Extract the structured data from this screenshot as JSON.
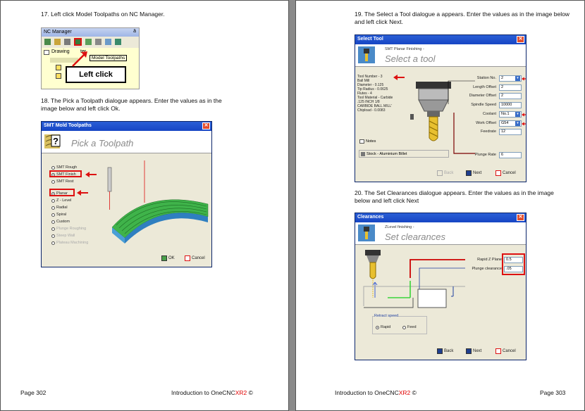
{
  "left_page": {
    "step17": "17. Left click Model Toolpaths on NC Manager.",
    "nc_manager": {
      "title": "NC Manager",
      "pin": "ä",
      "tree_drawing": "Drawing",
      "tree_partial": "ter",
      "tooltip": "Model Toolpaths",
      "callout": "Left click"
    },
    "step18": "18. The Pick a Toolpath dialogue appears. Enter the values as in the image below and left click Ok.",
    "toolpath_dialog": {
      "title": "SMT Mold Toolpaths",
      "heading": "Pick a Toolpath",
      "options": [
        "SMT Rough",
        "SMT Finish",
        "SMT Rest"
      ],
      "options2": [
        "Planar",
        "Z - Level",
        "Radial",
        "Spiral",
        "Custom"
      ],
      "disabled_options": [
        "Plunge Roughing",
        "Steep Wall",
        "Plateau Machining"
      ],
      "ok": "OK",
      "cancel": "Cancel"
    },
    "footer_page": "Page 302",
    "footer_title_a": "Introduction to OneCNC",
    "footer_title_b": "XR2",
    "footer_title_c": " ©"
  },
  "right_page": {
    "step19": "19. The Select a Tool dialogue a appears. Enter the values as in the image below and left click Next.",
    "select_tool": {
      "title": "Select Tool",
      "subtitle": "SMT Planar Finishing -",
      "heading": "Select a tool",
      "info": [
        "Tool Number - 3",
        "Ball Mill",
        "Diameter - 0.125",
        "Tip Radius - 0.0625",
        "Flutes - 4",
        "Tool Material - Carbide",
        ".125 INCH 1/8",
        "CARBIDE BALL MILL'",
        "Chipload - 0.0083"
      ],
      "fields": [
        {
          "label": "Station No.",
          "value": "2"
        },
        {
          "label": "Length Offset",
          "value": "2"
        },
        {
          "label": "Diameter Offset",
          "value": "2"
        },
        {
          "label": "Spindle Speed",
          "value": "10000"
        },
        {
          "label": "Coolant",
          "value": "No.1"
        },
        {
          "label": "Work Offset",
          "value": "G54"
        },
        {
          "label": "Feedrate",
          "value": "12"
        },
        {
          "label": "Plunge Rate",
          "value": "6"
        }
      ],
      "notes": "Notes",
      "stock": "Stock - Aluminium Billet",
      "back": "Back",
      "next": "Next",
      "cancel": "Cancel"
    },
    "step20": "20. The Set Clearances dialogue appears. Enter the values as in the image below and left click Next",
    "clearances": {
      "title": "Clearances",
      "subtitle": "ZLevel finishing -",
      "heading": "Set clearances",
      "rapid_label": "Rapid Z Plane",
      "rapid_value": "0.5",
      "plunge_label": "Plunge clearance",
      "plunge_value": ".05",
      "retract_label": "Retract speed",
      "retract_rapid": "Rapid",
      "retract_feed": "Feed",
      "back": "Back",
      "next": "Next",
      "cancel": "Cancel"
    },
    "footer_title_a": "Introduction to OneCNC",
    "footer_title_b": "XR2",
    "footer_title_c": " ©",
    "footer_page": "Page 303"
  }
}
